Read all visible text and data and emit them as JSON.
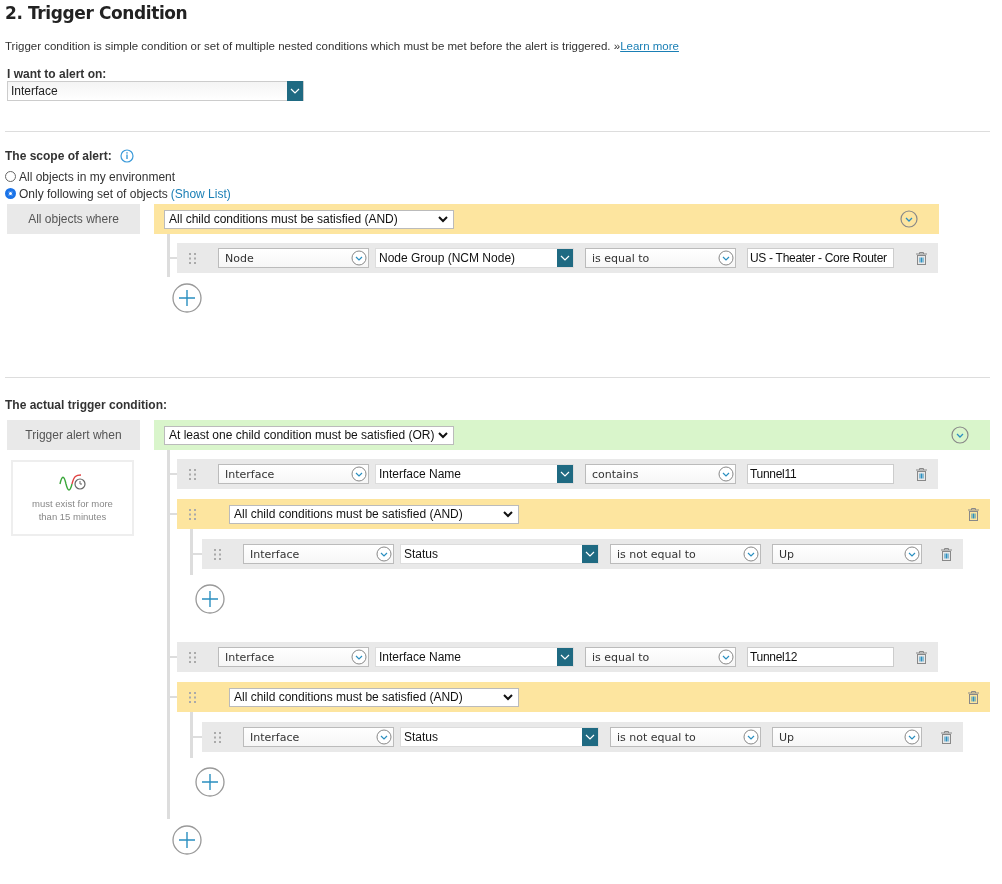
{
  "title": "2. Trigger Condition",
  "description": {
    "text": "Trigger condition is simple condition or set of multiple nested conditions which must be met before the alert is triggered. »",
    "link": "Learn more"
  },
  "alert_on": {
    "label": "I want to alert on:",
    "value": "Interface"
  },
  "sections": [
    {
      "label": "The scope of alert:",
      "options": [
        {
          "label": "All objects in my environment",
          "selected": false
        },
        {
          "label": "Only following set of objects",
          "link": "(Show List)",
          "selected": true
        }
      ],
      "tag": "All objects where",
      "group": {
        "color": "#fde59f",
        "operator": "All child conditions must be satisfied (AND)",
        "children": [
          {
            "kind": "condition",
            "object": "Node",
            "field": "Node Group (NCM Node)",
            "op": "is equal to",
            "value": {
              "kind": "text",
              "text": "US - Theater - Core Router"
            }
          }
        ]
      }
    },
    {
      "label": "The actual trigger condition:",
      "tag": "Trigger alert when",
      "duration": "must exist for more than 15 minutes",
      "group": {
        "color": "#d9f5cb",
        "operator": "At least one child condition must be satisfied (OR)",
        "children": [
          {
            "kind": "condition",
            "object": "Interface",
            "field": "Interface Name",
            "op": "contains",
            "value": {
              "kind": "text",
              "text": "Tunnel11"
            }
          },
          {
            "kind": "group",
            "color": "#fde59f",
            "operator": "All child conditions must be satisfied (AND)",
            "children": [
              {
                "kind": "condition",
                "object": "Interface",
                "field": "Status",
                "op": "is not equal to",
                "value": {
                  "kind": "select",
                  "text": "Up"
                }
              }
            ]
          },
          {
            "kind": "condition",
            "object": "Interface",
            "field": "Interface Name",
            "op": "is equal to",
            "value": {
              "kind": "text",
              "text": "Tunnel12"
            }
          },
          {
            "kind": "group",
            "color": "#fde59f",
            "operator": "All child conditions must be satisfied (AND)",
            "children": [
              {
                "kind": "condition",
                "object": "Interface",
                "field": "Status",
                "op": "is not equal to",
                "value": {
                  "kind": "select",
                  "text": "Up"
                }
              }
            ]
          }
        ]
      }
    }
  ]
}
